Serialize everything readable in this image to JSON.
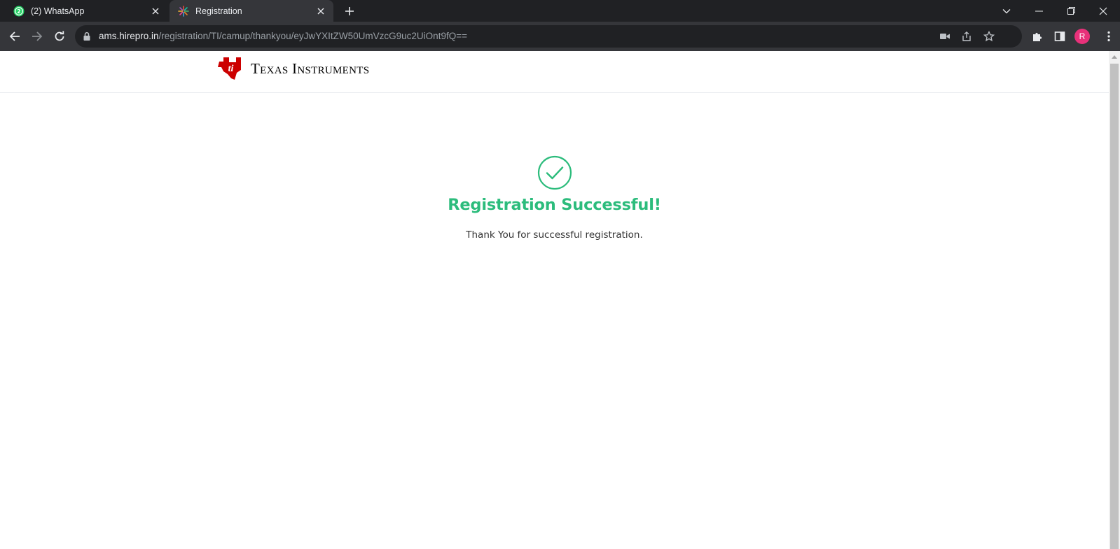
{
  "browser": {
    "tabs": [
      {
        "title": "(2) WhatsApp",
        "favicon": "whatsapp-icon",
        "active": false
      },
      {
        "title": "Registration",
        "favicon": "hirepro-icon",
        "active": true
      }
    ],
    "url_host": "ams.hirepro.in",
    "url_path": "/registration/TI/camup/thankyou/eyJwYXItZW50UmVzcG9uc2UiOnt9fQ==",
    "profile_initial": "R",
    "profile_color": "#e8317a",
    "whatsapp_badge": "2"
  },
  "page": {
    "logo_text": "Texas Instruments",
    "logo_color": "#cc0000",
    "success_icon": "check-circle-icon",
    "success_color": "#2cbc7c",
    "title": "Registration Successful!",
    "message": "Thank You for successful registration."
  }
}
